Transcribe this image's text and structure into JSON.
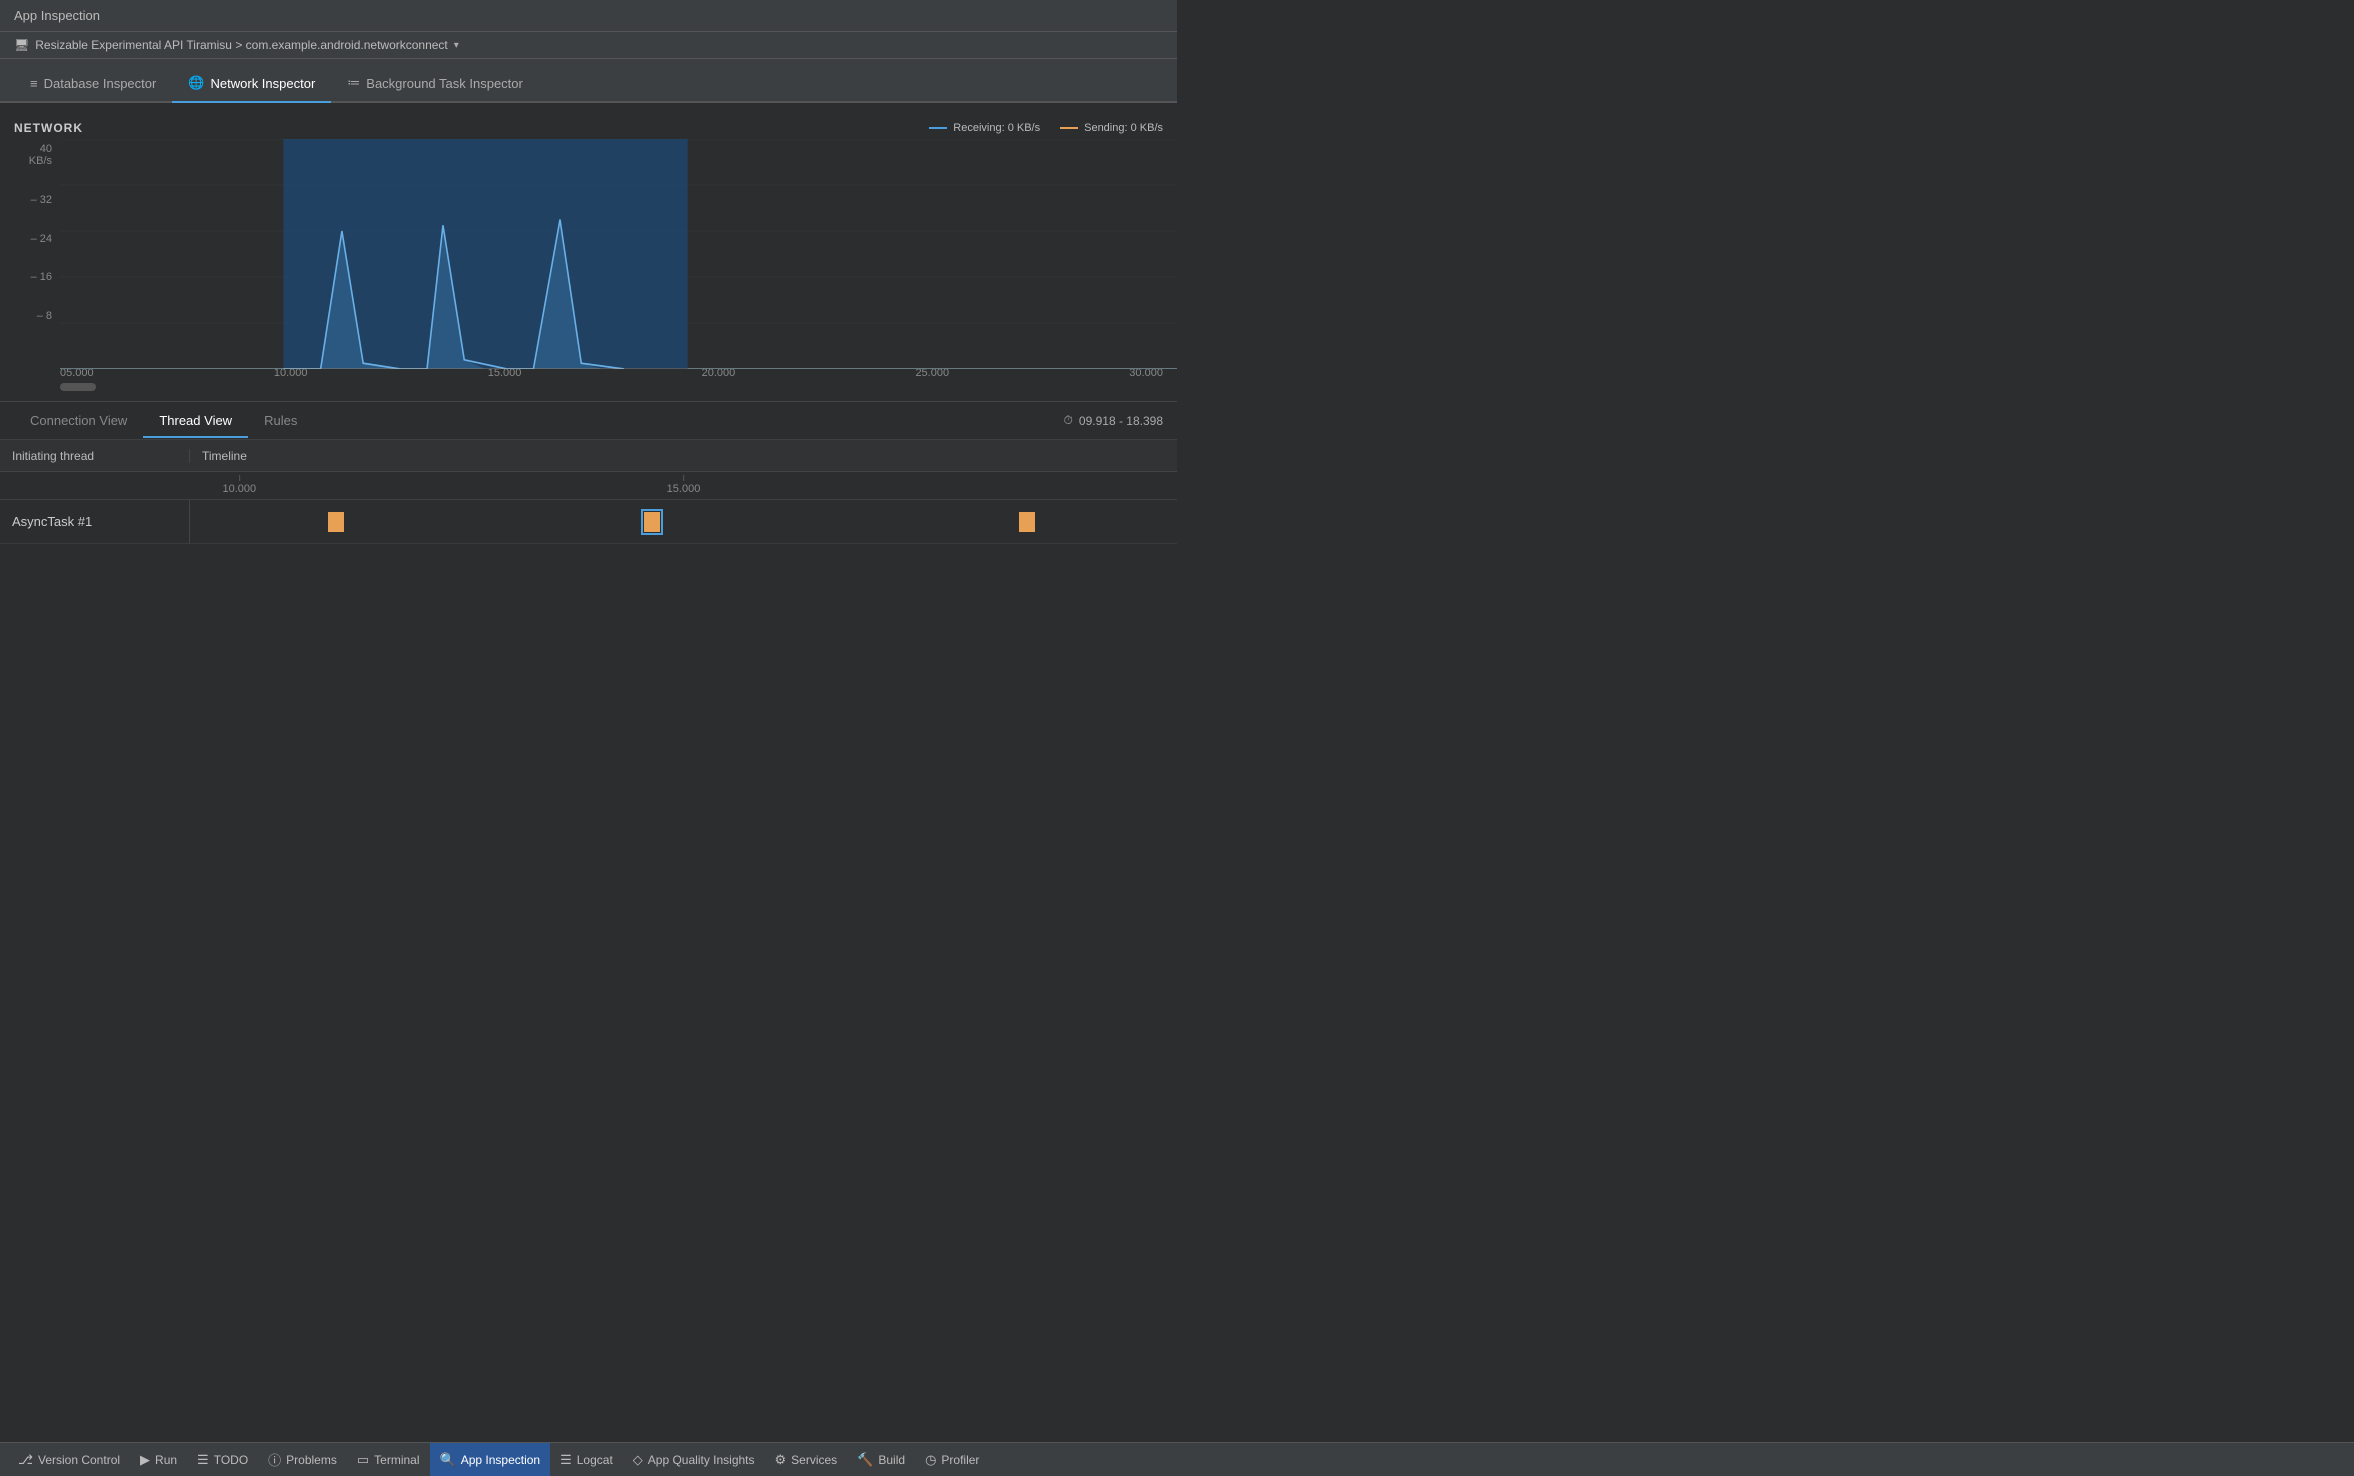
{
  "titleBar": {
    "title": "App Inspection"
  },
  "deviceBar": {
    "icon": "📱",
    "label": "Resizable Experimental API Tiramisu > com.example.android.networkconnect",
    "arrow": "▾"
  },
  "tabs": [
    {
      "id": "database",
      "label": "Database Inspector",
      "icon": "≡",
      "active": false
    },
    {
      "id": "network",
      "label": "Network Inspector",
      "icon": "🌐",
      "active": true
    },
    {
      "id": "background",
      "label": "Background Task Inspector",
      "icon": "≔",
      "active": false
    }
  ],
  "networkGraph": {
    "title": "NETWORK",
    "yAxisLabel": "40 KB/s",
    "yTicks": [
      "40",
      "32",
      "24",
      "16",
      "8",
      ""
    ],
    "legend": {
      "receiving": {
        "label": "Receiving: 0 KB/s",
        "color": "#4a9edd"
      },
      "sending": {
        "label": "Sending: 0 KB/s",
        "color": "#e8a055"
      }
    },
    "xTicks": [
      "05.000",
      "10.000",
      "15.000",
      "20.000",
      "25.000",
      "30.000"
    ]
  },
  "subTabs": [
    {
      "id": "connection",
      "label": "Connection View",
      "active": false
    },
    {
      "id": "thread",
      "label": "Thread View",
      "active": true
    },
    {
      "id": "rules",
      "label": "Rules",
      "active": false
    }
  ],
  "timeRange": "09.918 - 18.398",
  "threadTable": {
    "headers": {
      "initiating": "Initiating thread",
      "timeline": "Timeline"
    },
    "timeMarkers": [
      "10.000",
      "15.000"
    ],
    "rows": [
      {
        "name": "AsyncTask #1",
        "tasks": [
          {
            "id": "task1",
            "posPercent": 14,
            "selected": false
          },
          {
            "id": "task2",
            "posPercent": 46,
            "selected": true
          },
          {
            "id": "task3",
            "posPercent": 84,
            "selected": false
          }
        ]
      }
    ]
  },
  "statusBar": {
    "items": [
      {
        "id": "version-control",
        "icon": "⎇",
        "label": "Version Control"
      },
      {
        "id": "run",
        "icon": "▶",
        "label": "Run"
      },
      {
        "id": "todo",
        "icon": "☰",
        "label": "TODO"
      },
      {
        "id": "problems",
        "icon": "ⓘ",
        "label": "Problems"
      },
      {
        "id": "terminal",
        "icon": "⬜",
        "label": "Terminal"
      },
      {
        "id": "app-inspection",
        "icon": "🔍",
        "label": "App Inspection",
        "active": true
      },
      {
        "id": "logcat",
        "icon": "☰",
        "label": "Logcat"
      },
      {
        "id": "app-quality",
        "icon": "◇",
        "label": "App Quality Insights"
      },
      {
        "id": "services",
        "icon": "⚙",
        "label": "Services"
      },
      {
        "id": "build",
        "icon": "🔨",
        "label": "Build"
      },
      {
        "id": "profiler",
        "icon": "◷",
        "label": "Profiler"
      }
    ]
  }
}
